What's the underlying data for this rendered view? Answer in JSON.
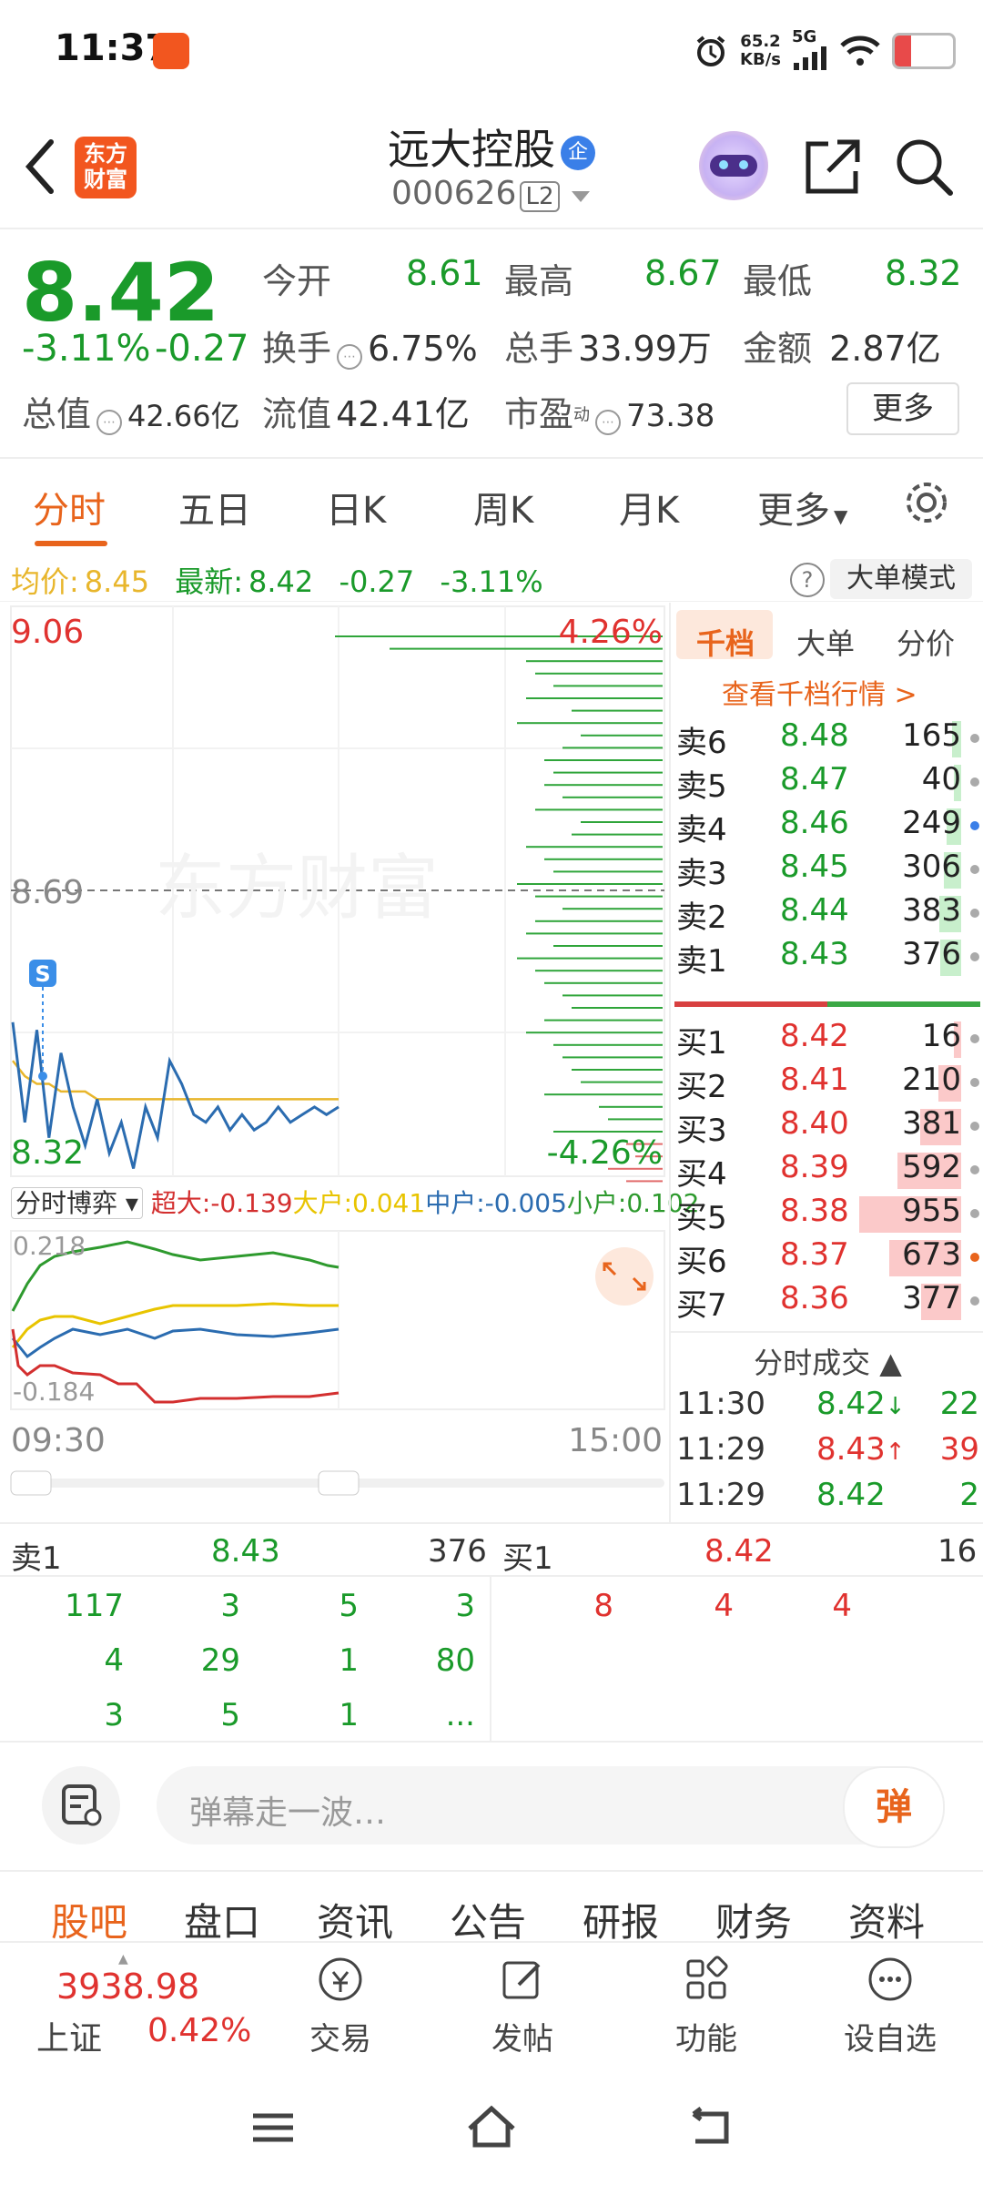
{
  "status": {
    "time": "11:37",
    "net_speed": "65.2",
    "net_unit": "KB/s",
    "signal": "5G",
    "battery": "8"
  },
  "header": {
    "logo_line1": "东方",
    "logo_line2": "财富",
    "stock_name": "远大控股",
    "name_badge": "企",
    "stock_code": "000626",
    "level_badge": "L2"
  },
  "quote": {
    "price": "8.42",
    "change_pct": "-3.11%",
    "change_val": "-0.27",
    "open_label": "今开",
    "open": "8.61",
    "high_label": "最高",
    "high": "8.67",
    "low_label": "最低",
    "low": "8.32",
    "turnover_label": "换手",
    "turnover": "6.75%",
    "volume_label": "总手",
    "volume": "33.99万",
    "amount_label": "金额",
    "amount": "2.87亿",
    "mktcap_label": "总值",
    "mktcap": "42.66亿",
    "float_label": "流值",
    "float_cap": "42.41亿",
    "pe_label": "市盈",
    "pe_sup": "动",
    "pe": "73.38",
    "more_label": "更多"
  },
  "tabs": [
    "分时",
    "五日",
    "日K",
    "周K",
    "月K",
    "更多"
  ],
  "avg_line": {
    "avg_label": "均价:",
    "avg": "8.45",
    "latest_label": "最新:",
    "latest": "8.42",
    "chg": "-0.27",
    "pct": "-3.11%",
    "mode_btn": "大单模式",
    "help": "?"
  },
  "chart": {
    "top_price": "9.06",
    "top_pct": "4.26%",
    "mid_price": "8.69",
    "bot_price": "8.32",
    "bot_pct": "-4.26%",
    "marker": "S",
    "watermark": "东方财富",
    "time_start": "09:30",
    "time_end": "15:00",
    "flow_selector": "分时博弈",
    "flow_super": "超大:-0.139",
    "flow_big": "大户:0.041",
    "flow_mid": "中户:-0.005",
    "flow_small": "小户:0.102",
    "flow_top": "0.218",
    "flow_bot": "-0.184",
    "colors": {
      "price": "#2b6cb0",
      "avg": "#e8b62c",
      "super": "#d32f2f",
      "big": "#e8c400",
      "mid": "#2b6cb0",
      "small": "#2e9a2e"
    }
  },
  "chart_data": {
    "type": "line",
    "title": "",
    "xlabel": "",
    "ylabel": "",
    "ylim": [
      8.32,
      9.06
    ],
    "series": [
      {
        "values": [
          8.52,
          8.39,
          8.51,
          8.37,
          8.48,
          8.41,
          8.36,
          8.42,
          8.35,
          8.39,
          8.33,
          8.41,
          8.37,
          8.47,
          8.44,
          8.4,
          8.39,
          8.41,
          8.38,
          8.4,
          8.38,
          8.39,
          8.41,
          8.39,
          8.4,
          8.41,
          8.4,
          8.41
        ]
      },
      {
        "values": [
          8.47,
          8.45,
          8.44,
          8.44,
          8.43,
          8.43,
          8.43,
          8.42,
          8.42,
          8.42,
          8.42,
          8.42,
          8.42,
          8.42,
          8.42,
          8.42,
          8.42,
          8.42,
          8.42,
          8.42,
          8.42,
          8.42,
          8.42,
          8.42,
          8.42,
          8.42,
          8.42,
          8.42
        ]
      }
    ]
  },
  "book": {
    "tab_active": "千档",
    "tab2": "大单",
    "tab3": "分价",
    "link": "查看千档行情 >",
    "sells": [
      {
        "label": "卖6",
        "price": "8.48",
        "vol": "165"
      },
      {
        "label": "卖5",
        "price": "8.47",
        "vol": "40"
      },
      {
        "label": "卖4",
        "price": "8.46",
        "vol": "249"
      },
      {
        "label": "卖3",
        "price": "8.45",
        "vol": "306"
      },
      {
        "label": "卖2",
        "price": "8.44",
        "vol": "383"
      },
      {
        "label": "卖1",
        "price": "8.43",
        "vol": "376"
      }
    ],
    "buys": [
      {
        "label": "买1",
        "price": "8.42",
        "vol": "16"
      },
      {
        "label": "买2",
        "price": "8.41",
        "vol": "210"
      },
      {
        "label": "买3",
        "price": "8.40",
        "vol": "381"
      },
      {
        "label": "买4",
        "price": "8.39",
        "vol": "592"
      },
      {
        "label": "买5",
        "price": "8.38",
        "vol": "955"
      },
      {
        "label": "买6",
        "price": "8.37",
        "vol": "673"
      },
      {
        "label": "买7",
        "price": "8.36",
        "vol": "377"
      }
    ],
    "ticks_title": "分时成交",
    "ticks": [
      {
        "time": "11:30",
        "price": "8.42",
        "arrow": "↓",
        "vol": "22"
      },
      {
        "time": "11:29",
        "price": "8.43",
        "arrow": "↑",
        "vol": "39"
      },
      {
        "time": "11:29",
        "price": "8.42",
        "arrow": "",
        "vol": "2"
      }
    ]
  },
  "queue": {
    "sell_label": "卖1",
    "sell_price": "8.43",
    "sell_vol": "376",
    "buy_label": "买1",
    "buy_price": "8.42",
    "buy_vol": "16",
    "sell_rows": [
      [
        "117",
        "3",
        "5",
        "3"
      ],
      [
        "4",
        "29",
        "1",
        "80"
      ],
      [
        "3",
        "5",
        "1",
        "..."
      ]
    ],
    "buy_rows": [
      [
        "8",
        "4",
        "4"
      ]
    ]
  },
  "danmaku": {
    "placeholder": "弹幕走一波…",
    "send": "弹"
  },
  "bottom_tabs": [
    "股吧",
    "盘口",
    "资讯",
    "公告",
    "研报",
    "财务",
    "资料"
  ],
  "toolbar": {
    "index_value": "3938.98",
    "index_name": "上证",
    "index_pct": "0.42%",
    "trade": "交易",
    "post": "发帖",
    "func": "功能",
    "watch": "设自选"
  }
}
